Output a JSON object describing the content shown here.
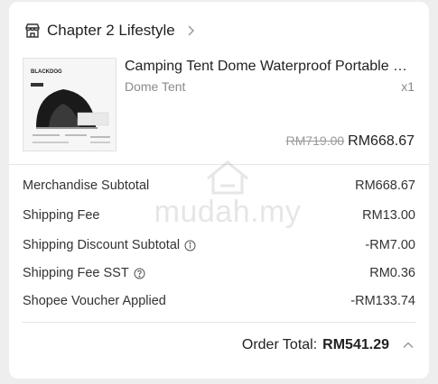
{
  "shop": {
    "name": "Chapter 2 Lifestyle",
    "icon": "store-icon"
  },
  "product": {
    "title": "Camping Tent Dome Waterproof Portable Outdoor Travel",
    "variant": "Dome Tent",
    "quantity": "x1",
    "original_price": "RM719.00",
    "price": "RM668.67",
    "thumbnail_brand": "BLACKDOG"
  },
  "summary": {
    "rows": [
      {
        "label": "Merchandise Subtotal",
        "value": "RM668.67",
        "info": false
      },
      {
        "label": "Shipping Fee",
        "value": "RM13.00",
        "info": false
      },
      {
        "label": "Shipping Discount Subtotal",
        "value": "-RM7.00",
        "info": true
      },
      {
        "label": "Shipping Fee SST",
        "value": "RM0.36",
        "info": true
      },
      {
        "label": "Shopee Voucher Applied",
        "value": "-RM133.74",
        "info": false
      }
    ]
  },
  "order_total": {
    "label": "Order Total:",
    "value": "RM541.29"
  },
  "watermark": {
    "text": "mudah.my"
  },
  "colors": {
    "text": "#222222",
    "muted": "#8a8a8a",
    "divider": "#e6e6e6"
  }
}
